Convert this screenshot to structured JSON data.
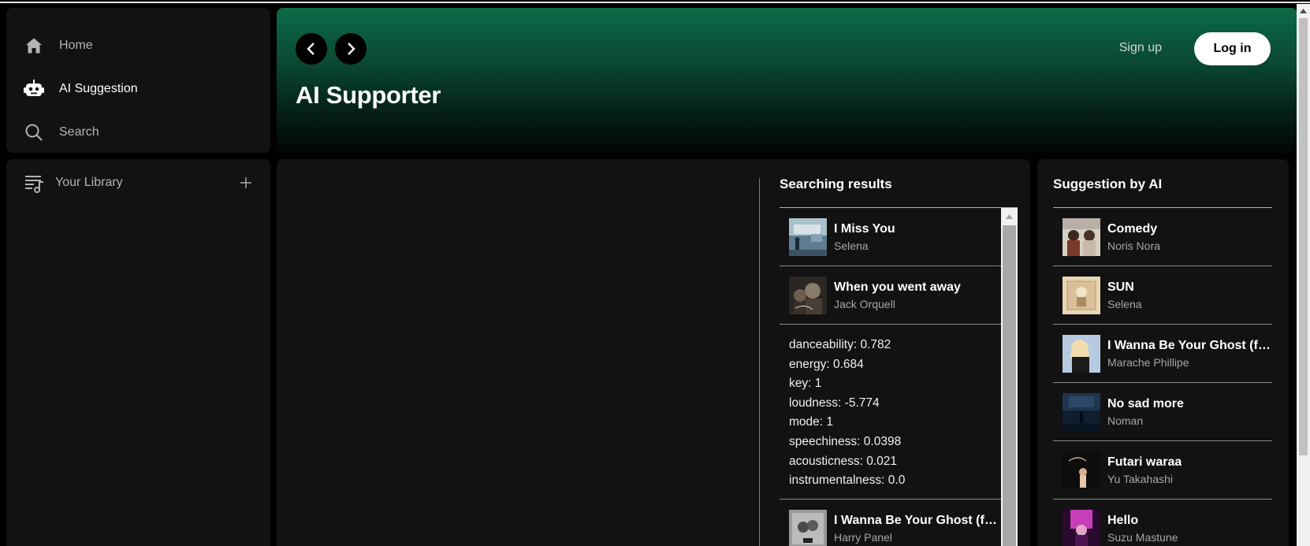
{
  "nav": {
    "items": [
      {
        "label": "Home",
        "icon": "home-icon"
      },
      {
        "label": "AI Suggestion",
        "icon": "robot-icon"
      },
      {
        "label": "Search",
        "icon": "search-icon"
      }
    ]
  },
  "library": {
    "label": "Your Library",
    "add_icon": "plus-icon"
  },
  "header": {
    "title": "AI Supporter",
    "signup_label": "Sign up",
    "login_label": "Log in",
    "gradient_color": "#0c6a47"
  },
  "results": {
    "title": "Searching results",
    "tracks": [
      {
        "title": "I Miss You",
        "artist": "Selena"
      },
      {
        "title": "When you went away",
        "artist": "Jack Orquell"
      }
    ],
    "features": [
      "danceability: 0.782",
      "energy: 0.684",
      "key: 1",
      "loudness: -5.774",
      "mode: 1",
      "speechiness: 0.0398",
      "acousticness: 0.021",
      "instrumentalness: 0.0"
    ],
    "tracks_after": [
      {
        "title": "I Wanna Be Your Ghost (fe...",
        "artist": "Harry Panel"
      }
    ]
  },
  "suggestions": {
    "title": "Suggestion by AI",
    "tracks": [
      {
        "title": "Comedy",
        "artist": "Noris Nora"
      },
      {
        "title": "SUN",
        "artist": "Selena"
      },
      {
        "title": "I Wanna Be Your Ghost (fe...",
        "artist": "Marache Phillipe"
      },
      {
        "title": "No sad more",
        "artist": "Noman"
      },
      {
        "title": "Futari waraa",
        "artist": "Yu Takahashi"
      },
      {
        "title": "Hello",
        "artist": "Suzu Mastune"
      }
    ]
  }
}
